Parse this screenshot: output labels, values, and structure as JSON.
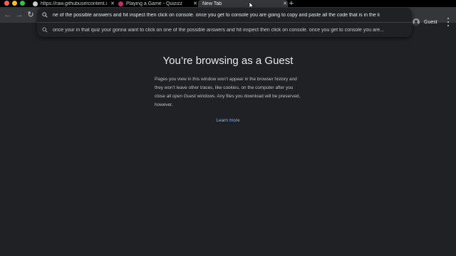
{
  "window": {
    "traffic_lights": [
      "#ff5f57",
      "#febc2e",
      "#28c840"
    ]
  },
  "tabs": [
    {
      "title": "https://raw.githubusercontent.com/...",
      "favicon": "globe-icon",
      "active": false
    },
    {
      "title": "Playing a Game - Quizizz",
      "favicon": "quizizz-icon",
      "active": false,
      "favicon_color": "#c0326b"
    },
    {
      "title": "New Tab",
      "favicon": "",
      "active": true
    }
  ],
  "toolbar": {
    "back_icon": "back-arrow-icon",
    "forward_icon": "forward-arrow-icon",
    "reload_icon": "reload-icon",
    "omnibox_value": "ne of the possible answers and hit inspect then click on console. once you get to console you are going to copy and paste all the code that is in the li",
    "suggestion": "once your in that quiz your gonna want to click on one of the possible answers and hit inspect then click on console. once you get to console you are...",
    "profile_label": "Guest"
  },
  "content": {
    "heading": "You’re browsing as a Guest",
    "description": "Pages you view in this window won’t appear in the browser history and they won’t leave other traces, like cookies, on the computer after you close all open Guest windows. Any files you download will be preserved, however.",
    "learn_more": "Learn more"
  },
  "colors": {
    "background": "#202124",
    "toolbar": "#35363a",
    "link": "#8ab4f8"
  }
}
